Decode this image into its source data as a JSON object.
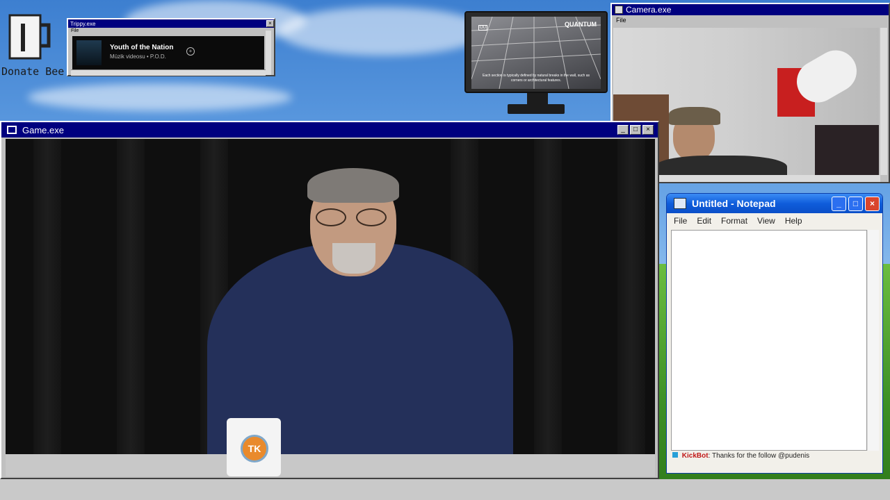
{
  "desktop": {
    "donate_label": "Donate Bee"
  },
  "trippy": {
    "title": "Trippy.exe",
    "menu_file": "File",
    "song_title": "Youth of the Nation",
    "song_sub": "Müzik videosu • P.O.D."
  },
  "monitor": {
    "brand": "QUANTUM",
    "corner_tag": "OU",
    "subtitle": "Each section is typically defined by natural breaks in the wall, such as corners or architectural features."
  },
  "camera": {
    "title": "Camera.exe",
    "menu_file": "File"
  },
  "game": {
    "title": "Game.exe",
    "mug_text": "TK"
  },
  "notepad": {
    "title": "Untitled - Notepad",
    "menu": [
      "File",
      "Edit",
      "Format",
      "View",
      "Help"
    ],
    "body": ""
  },
  "chat": {
    "user": "KickBot",
    "message": ": Thanks for the follow @pudenis"
  }
}
